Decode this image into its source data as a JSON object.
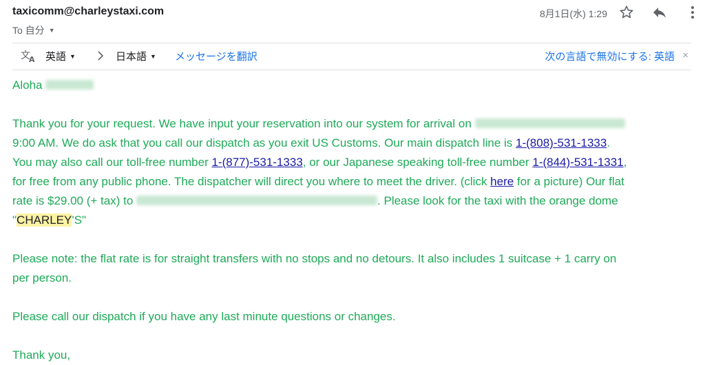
{
  "header": {
    "sender": "taxicomm@charleystaxi.com",
    "to_label": "To 自分",
    "timestamp": "8月1日(水) 1:29",
    "icons": [
      "star-icon",
      "reply-icon",
      "more-vert-icon"
    ]
  },
  "translate_bar": {
    "icon": "translate-icon",
    "source_lang": "英語",
    "target_lang": "日本語",
    "translate_link": "メッセージを翻訳",
    "disable_link": "次の言語で無効にする: 英語",
    "close": "×"
  },
  "email": {
    "greeting": "Aloha",
    "p1_a": "Thank you for your request.  We have input your reservation into our system for arrival on",
    "p1_b": "9:00 AM.  We do ask that you call our dispatch as you exit US Customs. Our main dispatch line is ",
    "phone_main": "1-(808)-531-1333",
    "p1_c": ".",
    "p1_d": "You may also call our toll-free number ",
    "phone_tollfree": "1-(877)-531-1333",
    "p1_e": ", or our Japanese speaking toll-free number ",
    "phone_japanese": "1-(844)-531-1331",
    "p1_f": ",",
    "p1_g": "for free from any public phone.  The dispatcher will direct you where to meet the driver.  (click ",
    "here_link": "here",
    "p1_h": " for a picture) Our flat",
    "p1_i": "rate is $29.00 (+ tax) to",
    "p1_j": ".  Please look for the taxi with the orange dome",
    "quote_open": "\"",
    "charley": "CHARLEY",
    "quote_close": "'S\"",
    "p2_a": "Please note: the flat rate is for straight transfers with no stops and no detours.  It also includes 1 suitcase + 1 carry on",
    "p2_b": "per person.",
    "p3": "Please call our dispatch if you have any last minute questions or changes.",
    "closing": "Thank you,"
  },
  "colors": {
    "body_text": "#1eaa58",
    "link": "#1a1aa6",
    "ui_link": "#1a73e8",
    "highlight": "#fbf3a4"
  }
}
